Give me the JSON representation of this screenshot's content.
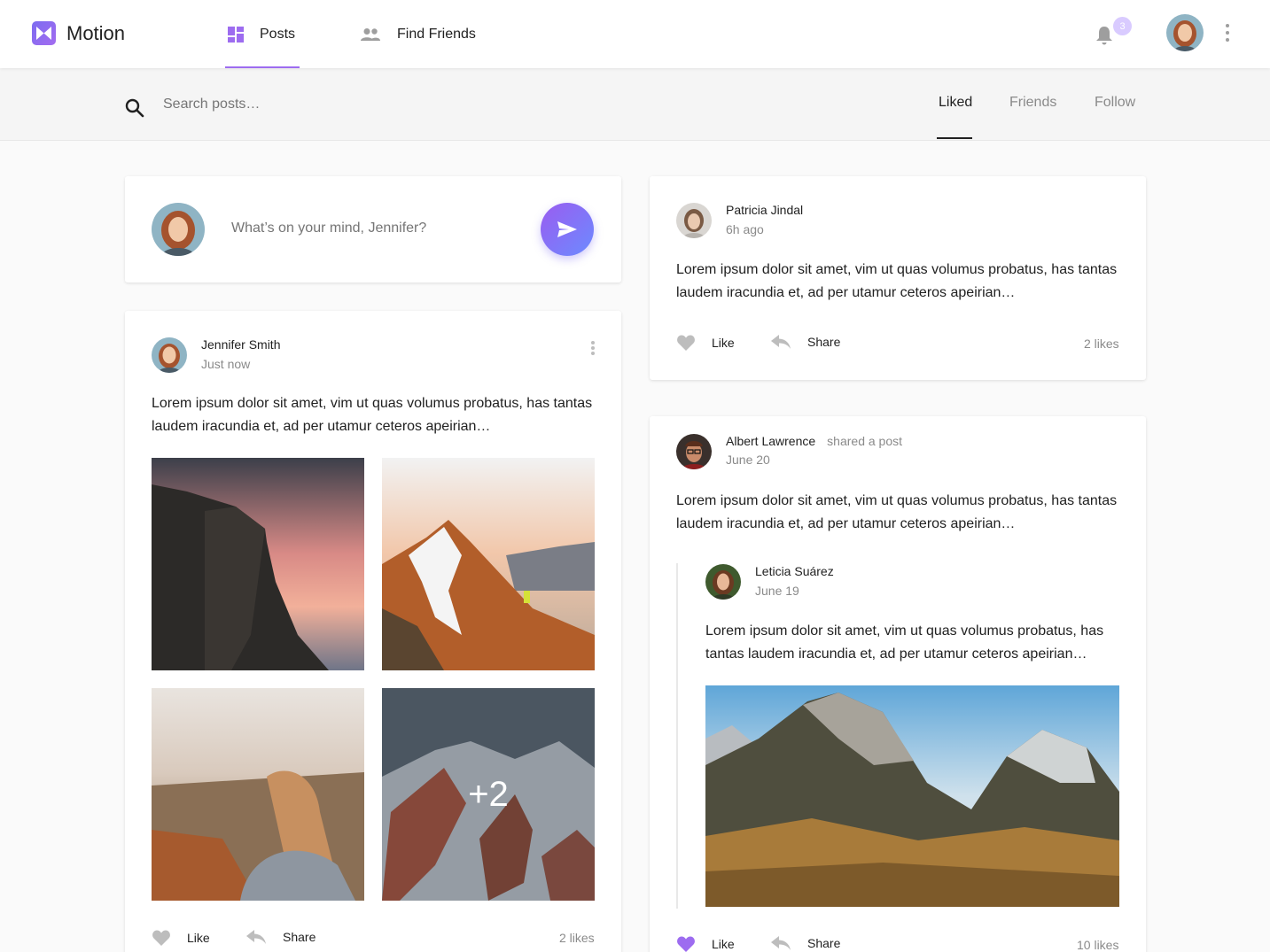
{
  "app": {
    "name": "Motion"
  },
  "nav": {
    "posts_label": "Posts",
    "find_friends_label": "Find Friends"
  },
  "notifications": {
    "count": "3"
  },
  "search": {
    "placeholder": "Search posts…"
  },
  "filter_tabs": [
    {
      "label": "Liked",
      "active": true
    },
    {
      "label": "Friends",
      "active": false
    },
    {
      "label": "Follow",
      "active": false
    }
  ],
  "composer": {
    "placeholder": "What’s on your mind, Jennifer?"
  },
  "posts": [
    {
      "author": "Jennifer Smith",
      "time": "Just now",
      "body": "Lorem ipsum dolor sit amet, vim ut quas volumus probatus, has tantas laudem iracundia et, ad per utamur ceteros apeirian…",
      "more_photos_label": "+2",
      "like_label": "Like",
      "share_label": "Share",
      "likes": "2 likes",
      "liked": false
    },
    {
      "author": "Patricia Jindal",
      "time": "6h ago",
      "body": "Lorem ipsum dolor sit amet, vim ut quas volumus probatus, has tantas laudem iracundia et, ad per utamur ceteros apeirian…",
      "like_label": "Like",
      "share_label": "Share",
      "likes": "2 likes",
      "liked": false
    },
    {
      "author": "Albert Lawrence",
      "shared_label": "shared a post",
      "time": "June 20",
      "body": "Lorem ipsum dolor sit amet, vim ut quas volumus probatus, has tantas laudem iracundia et, ad per utamur ceteros apeirian…",
      "shared": {
        "author": "Leticia Suárez",
        "time": "June 19",
        "body": "Lorem ipsum dolor sit amet, vim ut quas volumus probatus, has tantas laudem iracundia et, ad per utamur ceteros apeirian…"
      },
      "like_label": "Like",
      "share_label": "Share",
      "likes": "10 likes",
      "liked": true
    }
  ],
  "colors": {
    "accent": "#9d6cf0",
    "liked": "#9d6cf0",
    "muted": "#bdbdbd"
  }
}
